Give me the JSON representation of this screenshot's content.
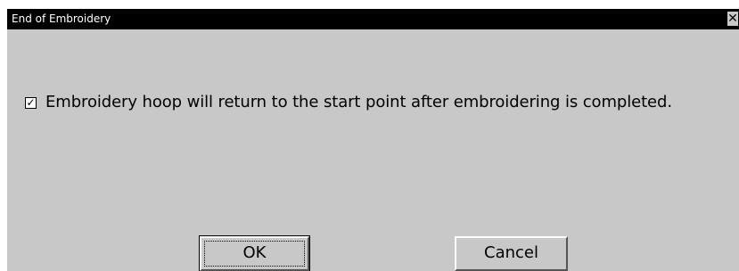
{
  "window": {
    "title": "End of Embroidery",
    "close_glyph": "✕"
  },
  "option": {
    "checked": true,
    "check_glyph": "✓",
    "label": "Embroidery hoop will return to the start point after embroidering is completed."
  },
  "buttons": {
    "ok_label": "OK",
    "cancel_label": "Cancel"
  },
  "colors": {
    "dialog_background": "#c8c8c8",
    "titlebar_background": "#000000",
    "titlebar_text": "#ffffff"
  }
}
